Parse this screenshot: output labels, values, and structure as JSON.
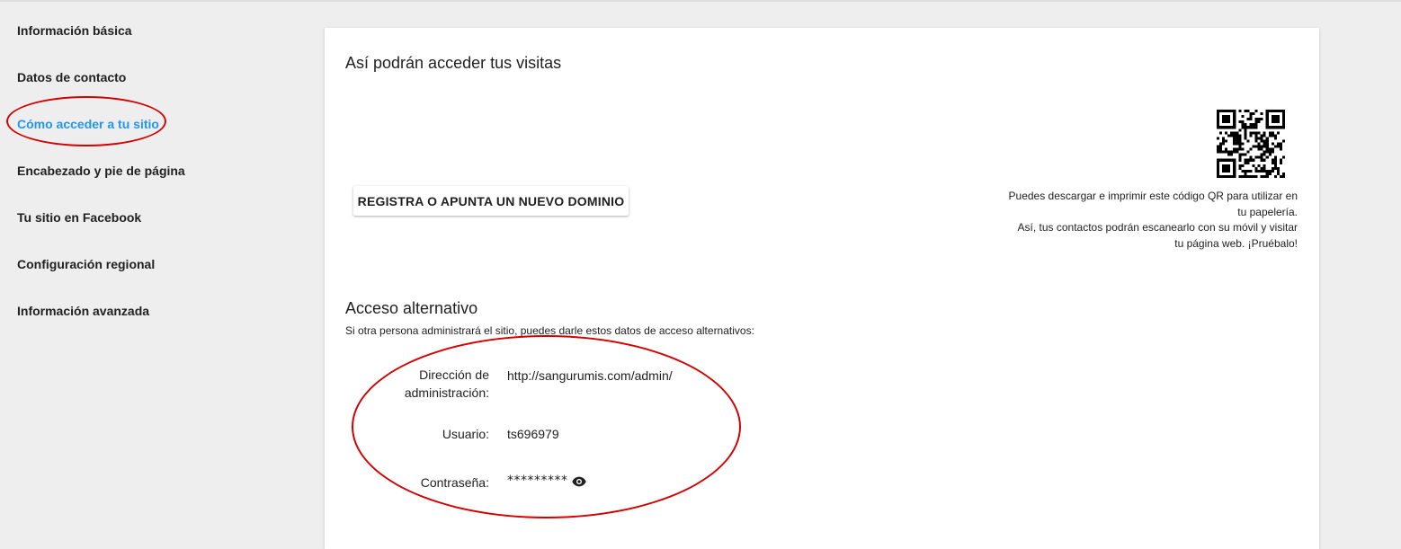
{
  "sidebar": {
    "items": [
      {
        "label": "Información básica",
        "active": false
      },
      {
        "label": "Datos de contacto",
        "active": false
      },
      {
        "label": "Cómo acceder a tu sitio",
        "active": true
      },
      {
        "label": "Encabezado y pie de página",
        "active": false
      },
      {
        "label": "Tu sitio en Facebook",
        "active": false
      },
      {
        "label": "Configuración regional",
        "active": false
      },
      {
        "label": "Información avanzada",
        "active": false
      }
    ]
  },
  "main": {
    "title": "Así podrán acceder tus visitas",
    "domain_button_label": "REGISTRA O APUNTA UN NUEVO DOMINIO",
    "qr": {
      "icon": "qr-code-icon",
      "text_lines": [
        "Puedes descargar e imprimir este código QR para utilizar en",
        "tu papelería.",
        "Así, tus contactos podrán escanearlo con su móvil y visitar",
        "tu página web. ¡Pruébalo!"
      ]
    },
    "alternate": {
      "title": "Acceso alternativo",
      "description": "Si otra persona administrará el sitio, puedes darle estos datos de acceso alternativos:",
      "admin_label_line1": "Dirección de",
      "admin_label_line2": "administración:",
      "admin_url": "http://sangurumis.com/admin/",
      "user_label": "Usuario:",
      "user_value": "ts696979",
      "password_label": "Contraseña:",
      "password_value": "*********",
      "password_icon": "eye-icon"
    }
  },
  "colors": {
    "accent": "#2196f3",
    "annotation": "#d50000",
    "background": "#eeeeee",
    "card": "#ffffff",
    "text": "#212121"
  }
}
